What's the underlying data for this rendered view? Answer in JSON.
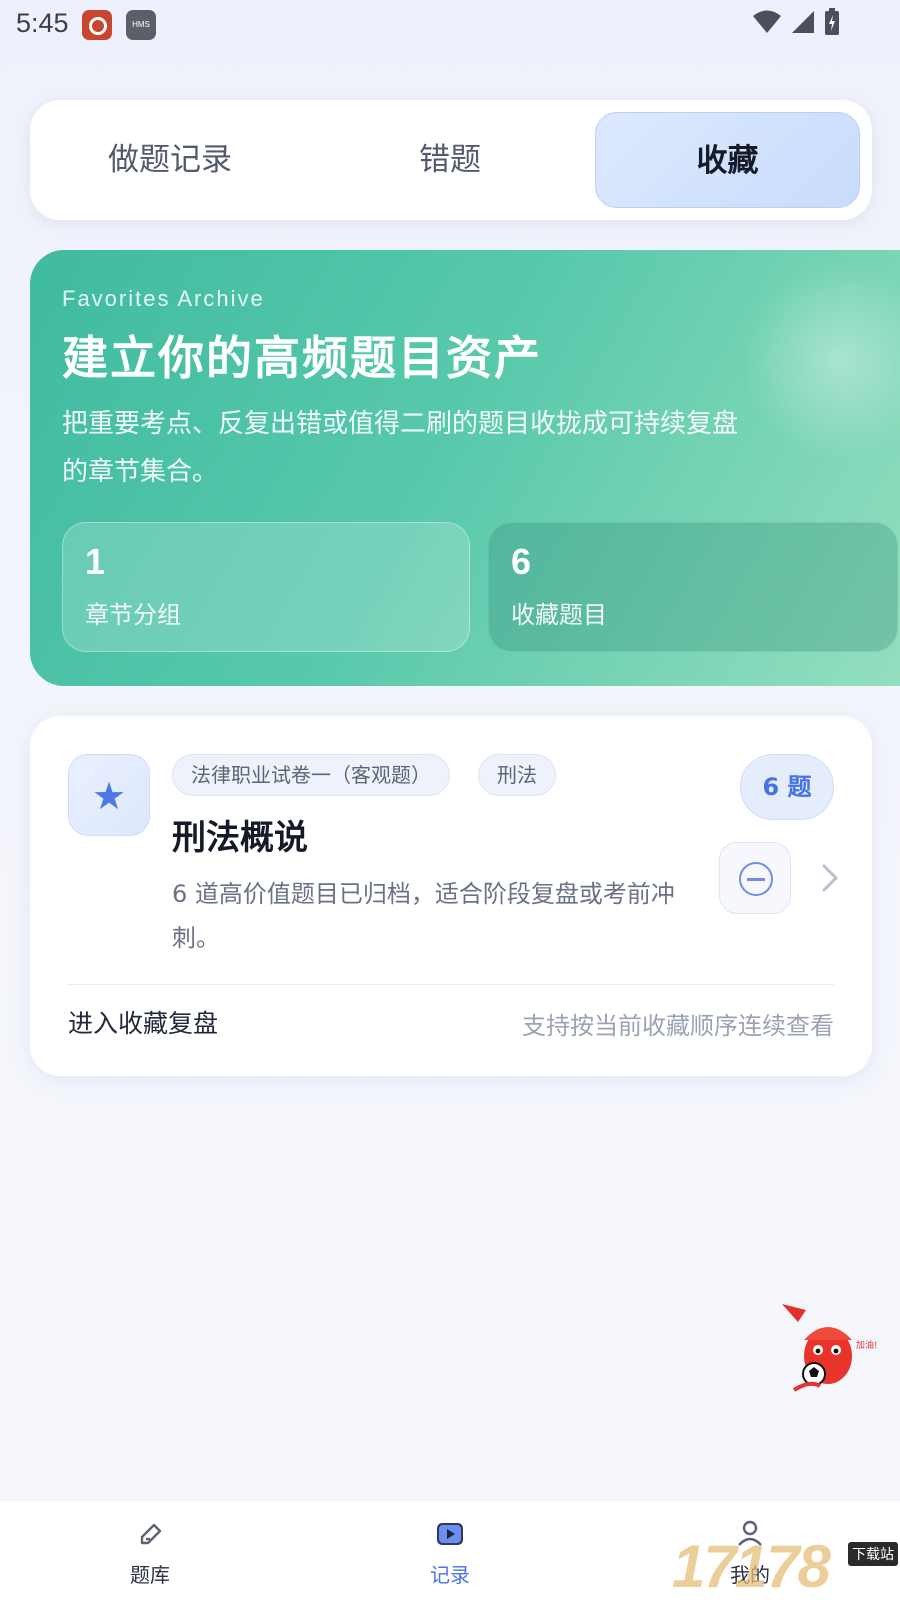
{
  "status_bar": {
    "time": "5:45",
    "app2_label": "HMS"
  },
  "tabs": [
    {
      "label": "做题记录"
    },
    {
      "label": "错题"
    },
    {
      "label": "收藏"
    }
  ],
  "hero": {
    "eyebrow": "Favorites Archive",
    "title": "建立你的高频题目资产",
    "description": "把重要考点、反复出错或值得二刷的题目收拢成可持续复盘的章节集合。",
    "stats": [
      {
        "value": "1",
        "label": "章节分组"
      },
      {
        "value": "6",
        "label": "收藏题目"
      }
    ]
  },
  "card": {
    "icon": "star-icon",
    "tags": [
      "法律职业试卷一（客观题）",
      "刑法"
    ],
    "count_badge": "6 题",
    "title": "刑法概说",
    "description": "6 道高价值题目已归档，适合阶段复盘或考前冲刺。",
    "action_label": "进入收藏复盘",
    "hint": "支持按当前收藏顺序连续查看"
  },
  "bottom_nav": [
    {
      "label": "题库",
      "icon": "pencil-icon"
    },
    {
      "label": "记录",
      "icon": "play-record-icon"
    },
    {
      "label": "我的",
      "icon": "user-icon"
    }
  ],
  "watermark": {
    "text": "17178",
    "badge": "下载站"
  },
  "colors": {
    "accent": "#4a73e3",
    "hero_start": "#3fbba0",
    "hero_end": "#93dfc0"
  }
}
